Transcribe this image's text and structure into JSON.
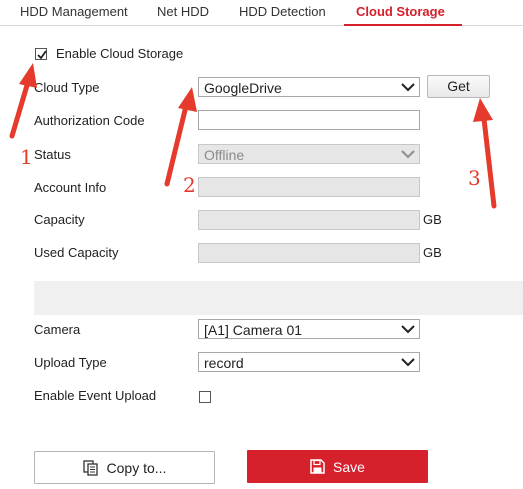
{
  "tabs": [
    {
      "label": "HDD Management",
      "active": false
    },
    {
      "label": "Net HDD",
      "active": false
    },
    {
      "label": "HDD Detection",
      "active": false
    },
    {
      "label": "Cloud Storage",
      "active": true
    }
  ],
  "enable_cloud": {
    "label": "Enable Cloud Storage",
    "checked": true
  },
  "cloud_type": {
    "label": "Cloud Type",
    "value": "GoogleDrive",
    "get_label": "Get"
  },
  "authorization_code": {
    "label": "Authorization Code",
    "value": ""
  },
  "status": {
    "label": "Status",
    "value": "Offline"
  },
  "account_info": {
    "label": "Account Info",
    "value": ""
  },
  "capacity": {
    "label": "Capacity",
    "value": "",
    "unit": "GB"
  },
  "used_capacity": {
    "label": "Used Capacity",
    "value": "",
    "unit": "GB"
  },
  "camera": {
    "label": "Camera",
    "value": "[A1] Camera 01"
  },
  "upload_type": {
    "label": "Upload Type",
    "value": "record"
  },
  "enable_event_upload": {
    "label": "Enable Event Upload",
    "checked": false
  },
  "buttons": {
    "copy_label": "Copy to...",
    "save_label": "Save"
  },
  "annotations": {
    "n1": "1",
    "n2": "2",
    "n3": "3"
  },
  "colors": {
    "accent": "#d6202c",
    "annotation": "#e53a2c"
  }
}
